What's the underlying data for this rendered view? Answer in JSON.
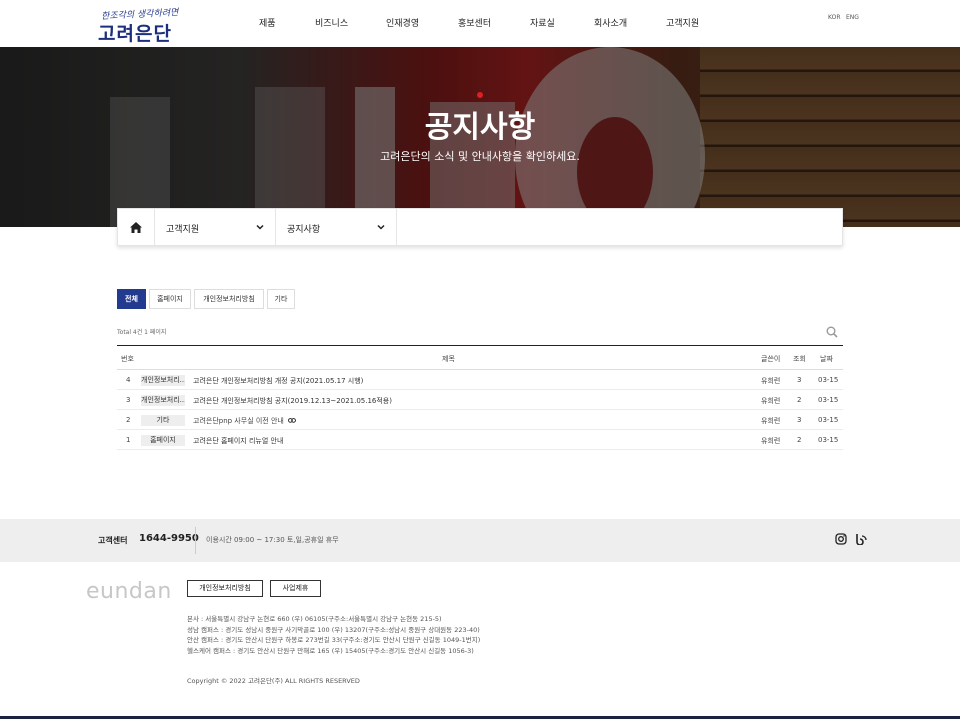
{
  "header": {
    "logo_tagline": "한조각의 생각하려면",
    "logo_text": "고려은단",
    "nav": [
      "제품",
      "비즈니스",
      "인재경영",
      "홍보센터",
      "자료실",
      "회사소개",
      "고객지원"
    ],
    "lang": [
      "KOR",
      "ENG"
    ]
  },
  "hero": {
    "title": "공지사항",
    "subtitle": "고려은단의 소식 및 안내사항을 확인하세요."
  },
  "location": {
    "depth1": "고객지원",
    "depth2": "공지사항"
  },
  "tabs": [
    {
      "label": "전체",
      "active": true
    },
    {
      "label": "홈페이지",
      "active": false
    },
    {
      "label": "개인정보처리방침",
      "active": false
    },
    {
      "label": "기타",
      "active": false
    }
  ],
  "board": {
    "total": "Total 4건 1 페이지",
    "columns": {
      "no": "번호",
      "title": "제목",
      "author": "글쓴이",
      "views": "조회",
      "date": "날짜"
    },
    "rows": [
      {
        "no": "4",
        "category": "개인정보처리...",
        "title": "고려은단 개인정보처리방침 개정 공지(2021.05.17 시행)",
        "author": "유희련",
        "views": "3",
        "date": "03-15",
        "link": false
      },
      {
        "no": "3",
        "category": "개인정보처리...",
        "title": "고려은단 개인정보처리방침 공지(2019.12.13~2021.05.16적용)",
        "author": "유희련",
        "views": "2",
        "date": "03-15",
        "link": false
      },
      {
        "no": "2",
        "category": "기타",
        "title": "고려은단pnp 사무실 이전 안내",
        "author": "유희련",
        "views": "3",
        "date": "03-15",
        "link": true
      },
      {
        "no": "1",
        "category": "홈페이지",
        "title": "고려은단 홈페이지 리뉴얼 안내",
        "author": "유희련",
        "views": "2",
        "date": "03-15",
        "link": false
      }
    ]
  },
  "contact": {
    "label": "고객센터",
    "tel": "1644-9950",
    "hours": "이용시간 09:00 ~ 17:30 토,일,공휴일 휴무"
  },
  "footer": {
    "logo": "eundan",
    "buttons": [
      "개인정보처리방침",
      "사업제휴"
    ],
    "address": [
      "본사 : 서울특별시 강남구 논현로 660 (우) 06105(구주소:서울특별시 강남구 논현동 215-5)",
      "성남 캠퍼스 : 경기도 성남시 중원구 사기막골로 100 (우) 13207(구주소:성남시 중원구 상대원동 223-40)",
      "안산 캠퍼스 : 경기도 안산시 단원구 하봉로 273번길 33(구주소:경기도 안산시 단원구 신길동 1049-1번지)",
      "헬스케어 캠퍼스 : 경기도 안산시 단원구 만해로 165 (우) 15405(구주소:경기도 안산시 신길동 1056-3)"
    ],
    "copyright": "Copyright © 2022 고려은단(주) ALL RIGHTS RESERVED"
  }
}
